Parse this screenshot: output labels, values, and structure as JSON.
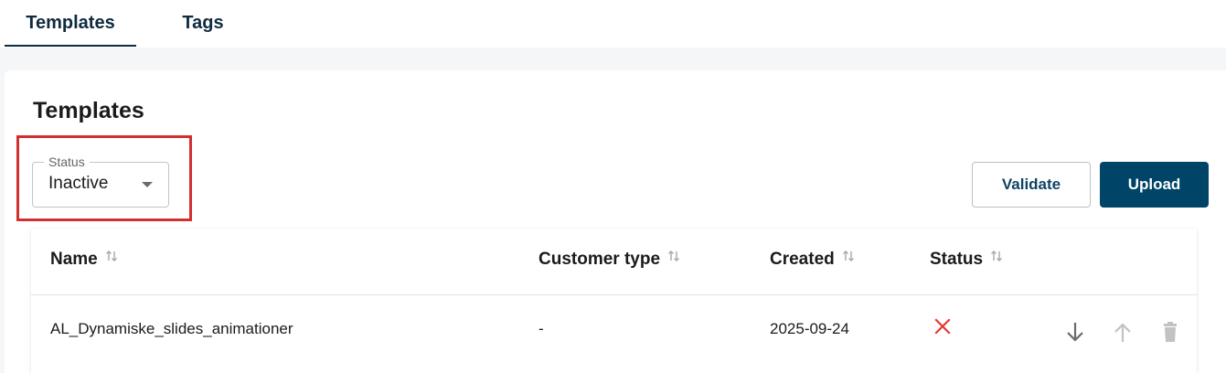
{
  "tabs": [
    {
      "label": "Templates",
      "active": true
    },
    {
      "label": "Tags",
      "active": false
    }
  ],
  "page": {
    "title": "Templates"
  },
  "filter": {
    "status_label": "Status",
    "status_value": "Inactive"
  },
  "actions": {
    "validate_label": "Validate",
    "upload_label": "Upload"
  },
  "table": {
    "columns": [
      "Name",
      "Customer type",
      "Created",
      "Status"
    ],
    "rows": [
      {
        "name": "AL_Dynamiske_slides_animationer",
        "customer_type": "-",
        "created": "2025-09-24",
        "status_icon": "x-icon"
      }
    ]
  },
  "colors": {
    "primary": "#004467",
    "tab_text": "#0f2b3f",
    "highlight": "#d32f2f",
    "status_inactive": "#e53935"
  }
}
